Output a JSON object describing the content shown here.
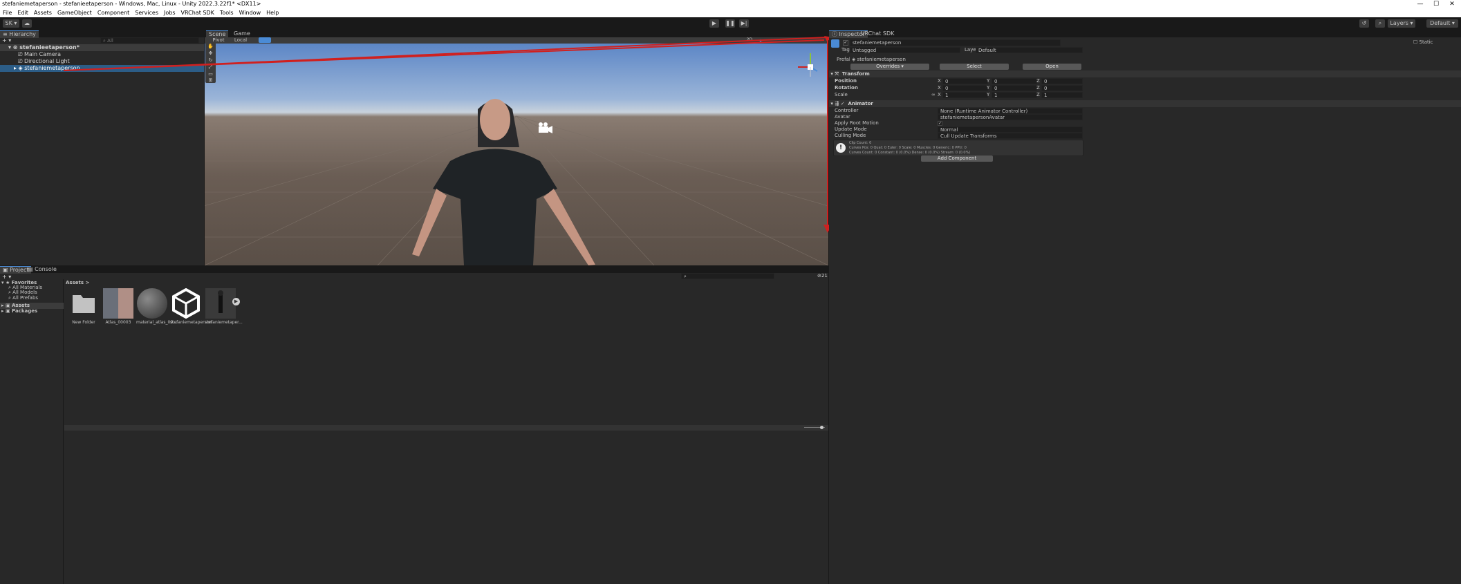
{
  "window": {
    "title": "stefaniemetaperson - stefanieetaperson - Windows, Mac, Linux - Unity 2022.3.22f1* <DX11>",
    "minimize": "—",
    "maximize": "☐",
    "close": "✕"
  },
  "menu": [
    "File",
    "Edit",
    "Assets",
    "GameObject",
    "Component",
    "Services",
    "Jobs",
    "VRChat SDK",
    "Tools",
    "Window",
    "Help"
  ],
  "toolbar": {
    "account": "SK ▾",
    "layers": "Layers",
    "layout": "Default"
  },
  "hierarchy": {
    "tab": "Hierarchy",
    "search_placeholder": "All",
    "scene": "stefanieetaperson*",
    "items": [
      "Main Camera",
      "Directional Light",
      "stefaniemetaperson"
    ]
  },
  "scene": {
    "tab_scene": "Scene",
    "tab_game": "Game",
    "pivot": "Pivot",
    "local": "Local",
    "mode_2d": "2D"
  },
  "inspector": {
    "tab_inspector": "Inspector",
    "tab_vrchat": "VRChat SDK",
    "object_name": "stefaniemetaperson",
    "static": "Static",
    "tag_label": "Tag",
    "tag_value": "Untagged",
    "layer_label": "Layer",
    "layer_value": "Default",
    "prefab_label": "Prefab",
    "prefab_value": "stefaniemetaperson",
    "overrides": "Overrides",
    "select": "Select",
    "open": "Open",
    "transform": {
      "title": "Transform",
      "rows": [
        {
          "label": "Position",
          "x": "0",
          "y": "0",
          "z": "0"
        },
        {
          "label": "Rotation",
          "x": "0",
          "y": "0",
          "z": "0"
        },
        {
          "label": "Scale",
          "x": "1",
          "y": "1",
          "z": "1"
        }
      ]
    },
    "animator": {
      "title": "Animator",
      "controller_label": "Controller",
      "controller_value": "None (Runtime Animator Controller)",
      "avatar_label": "Avatar",
      "avatar_value": "stefaniemetapersonAvatar",
      "root_motion_label": "Apply Root Motion",
      "update_label": "Update Mode",
      "update_value": "Normal",
      "culling_label": "Culling Mode",
      "culling_value": "Cull Update Transforms",
      "info_1": "Clip Count: 0",
      "info_2": "Curves Pos: 0 Quat: 0 Euler: 0 Scale: 0 Muscles: 0 Generic: 0 PPtr: 0",
      "info_3": "Curves Count: 0 Constant: 0 (0.0%) Dense: 0 (0.0%) Stream: 0 (0.0%)"
    },
    "add_component": "Add Component"
  },
  "project": {
    "tab_project": "Project",
    "tab_console": "Console",
    "badge": "21",
    "favorites": "Favorites",
    "fav_items": [
      "All Materials",
      "All Models",
      "All Prefabs"
    ],
    "assets": "Assets",
    "packages": "Packages",
    "breadcrumb": "Assets",
    "files": [
      "New Folder",
      "Atlas_00003",
      "material_atlas_00...",
      "stefaniemetaperson",
      "stefaniemetaper..."
    ]
  },
  "colors": {
    "accent": "#4a8bd6",
    "selection": "#2c5d87",
    "arrow": "#d0201f",
    "sky_top": "#5c86c6",
    "ground": "#6a5d54"
  }
}
